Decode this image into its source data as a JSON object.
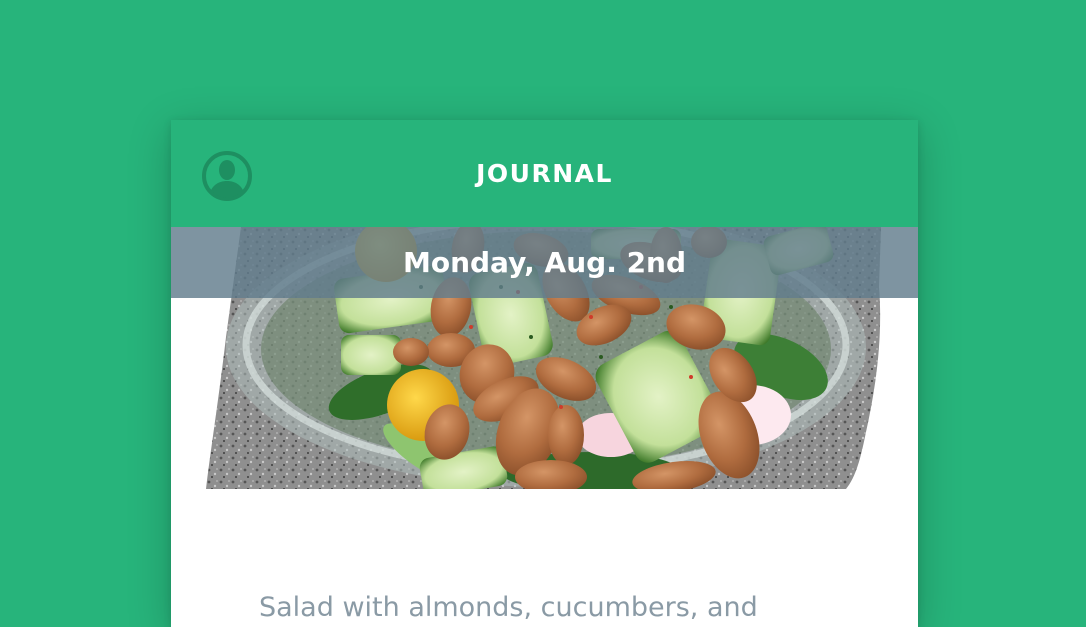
{
  "header": {
    "title": "JOURNAL",
    "avatar_icon": "user-icon"
  },
  "entry": {
    "date": "Monday, Aug. 2nd",
    "caption": "Salad with almonds, cucumbers, and",
    "photo_icon": "salad-photo"
  },
  "colors": {
    "background": "#27b47b",
    "header": "#27b47b",
    "date_bar": "#627d8c",
    "caption_text": "#8a9aa5"
  }
}
